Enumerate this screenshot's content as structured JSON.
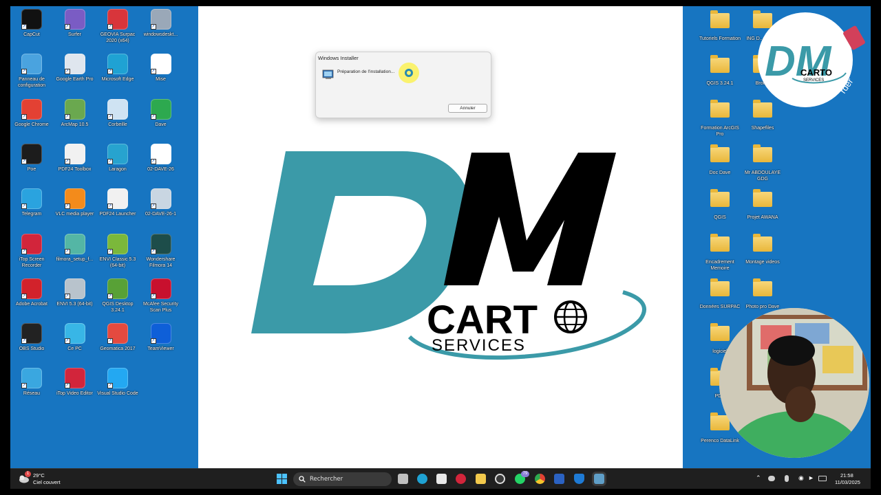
{
  "desktop_left": [
    {
      "label": "CapCut",
      "icon": "capcut-icon",
      "color": "#111111"
    },
    {
      "label": "Surfer",
      "icon": "surfer-icon",
      "color": "#7a5cc4"
    },
    {
      "label": "GEOVIA Surpac 2020 (x64)",
      "icon": "geovia-surpac-icon",
      "color": "#d8353b"
    },
    {
      "label": "windowsdeskt...",
      "icon": "installer-icon",
      "color": "#9aa8b8"
    },
    {
      "label": "Panneau de configuration",
      "icon": "control-panel-icon",
      "color": "#4aa3df"
    },
    {
      "label": "Google Earth Pro",
      "icon": "google-earth-icon",
      "color": "#dfe6ee"
    },
    {
      "label": "Microsoft Edge",
      "icon": "edge-icon",
      "color": "#1fa2d3"
    },
    {
      "label": "Mise",
      "icon": "pdf-icon",
      "color": "#ffffff"
    },
    {
      "label": "Google Chrome",
      "icon": "chrome-icon",
      "color": "#e34133"
    },
    {
      "label": "ArcMap 10.5",
      "icon": "arcmap-icon",
      "color": "#6aa84f"
    },
    {
      "label": "Corbeille",
      "icon": "recycle-bin-icon",
      "color": "#cfe3f3"
    },
    {
      "label": "Dave",
      "icon": "chrome-icon",
      "color": "#2da94f"
    },
    {
      "label": "Poe",
      "icon": "poe-icon",
      "color": "#1c1c1c"
    },
    {
      "label": "PDF24 Toolbox",
      "icon": "pdf24-icon",
      "color": "#f1f1f1"
    },
    {
      "label": "Laragon",
      "icon": "laragon-icon",
      "color": "#27a3cf"
    },
    {
      "label": "02-DAVE-26",
      "icon": "pdf-icon",
      "color": "#ffffff"
    },
    {
      "label": "Telegram",
      "icon": "telegram-icon",
      "color": "#2aa3df"
    },
    {
      "label": "VLC media player",
      "icon": "vlc-icon",
      "color": "#f38b1b"
    },
    {
      "label": "PDF24 Launcher",
      "icon": "pdf24-icon",
      "color": "#f1f1f1"
    },
    {
      "label": "02-DAVE-26-1",
      "icon": "photo-icon",
      "color": "#c9d6e2"
    },
    {
      "label": "iTop Screen Recorder",
      "icon": "itop-recorder-icon",
      "color": "#d2253b"
    },
    {
      "label": "filmora_setup_f...",
      "icon": "filmora-setup-icon",
      "color": "#54b6a5"
    },
    {
      "label": "ENVI Classic 5.3 (64-bit)",
      "icon": "envi-classic-icon",
      "color": "#7bb83b"
    },
    {
      "label": "Wondershare Filmora 14",
      "icon": "filmora-icon",
      "color": "#1d4d4a"
    },
    {
      "label": "Adobe Acrobat",
      "icon": "acrobat-icon",
      "color": "#d2222b"
    },
    {
      "label": "ENVI 5.3 (64-bit)",
      "icon": "envi-icon",
      "color": "#b8c3cc"
    },
    {
      "label": "QGIS Desktop 3.24.1",
      "icon": "qgis-icon",
      "color": "#58a136"
    },
    {
      "label": "McAfee Security Scan Plus",
      "icon": "mcafee-icon",
      "color": "#c8102e"
    },
    {
      "label": "OBS Studio",
      "icon": "obs-icon",
      "color": "#222222"
    },
    {
      "label": "Ce PC",
      "icon": "pc-icon",
      "color": "#38b6e6"
    },
    {
      "label": "Geomatica 2017",
      "icon": "geomatica-icon",
      "color": "#e44a3f"
    },
    {
      "label": "TeamViewer",
      "icon": "teamviewer-icon",
      "color": "#0e5fd8"
    },
    {
      "label": "Réseau",
      "icon": "network-icon",
      "color": "#3aa7e0"
    },
    {
      "label": "iTop Video Editor",
      "icon": "itop-editor-icon",
      "color": "#d2253b"
    },
    {
      "label": "Visual Studio Code",
      "icon": "vscode-icon",
      "color": "#23a8f2"
    }
  ],
  "desktop_right": [
    {
      "label": "Tutoriels Formation",
      "icon": "folder-icon"
    },
    {
      "label": "ING D... TCH...",
      "icon": "folder-icon"
    },
    {
      "label": "QGIS 3.24.1",
      "icon": "folder-icon"
    },
    {
      "label": "Brou...",
      "icon": "folder-icon"
    },
    {
      "label": "Formation ArcGIS Pro",
      "icon": "folder-icon"
    },
    {
      "label": "Shapefiles",
      "icon": "folder-icon"
    },
    {
      "label": "Doc Dave",
      "icon": "folder-icon"
    },
    {
      "label": "Mr ABDOULAYE GDG",
      "icon": "folder-icon"
    },
    {
      "label": "QGIS",
      "icon": "folder-icon"
    },
    {
      "label": "Projet AWANA",
      "icon": "folder-icon"
    },
    {
      "label": "Encadrement Memoire",
      "icon": "folder-icon"
    },
    {
      "label": "Montage videos",
      "icon": "folder-icon"
    },
    {
      "label": "Données SURPAC",
      "icon": "folder-icon"
    },
    {
      "label": "Photo pro Dave",
      "icon": "folder-icon"
    },
    {
      "label": "logiciel",
      "icon": "folder-icon"
    },
    {
      "label": "PDD",
      "icon": "folder-icon"
    },
    {
      "label": "Perenco DataLink",
      "icon": "folder-icon"
    }
  ],
  "dialog": {
    "title": "Windows Installer",
    "message": "Préparation de l'installation...",
    "cancel": "Annuler"
  },
  "logo": {
    "letter_d": "D",
    "letter_m": "M",
    "carto": "CART",
    "services": "SERVICES",
    "teal": "#3b9aa8"
  },
  "badge": {
    "letters": "DM",
    "carto": "CARTO",
    "services": "SERVICES",
    "ribbon_text": "rder"
  },
  "taskbar": {
    "weather_temp": "29°C",
    "weather_desc": "Ciel couvert",
    "weather_badge": "1",
    "search_placeholder": "Rechercher",
    "whatsapp_badge": "79",
    "time": "21:58",
    "date": "11/03/2025"
  }
}
